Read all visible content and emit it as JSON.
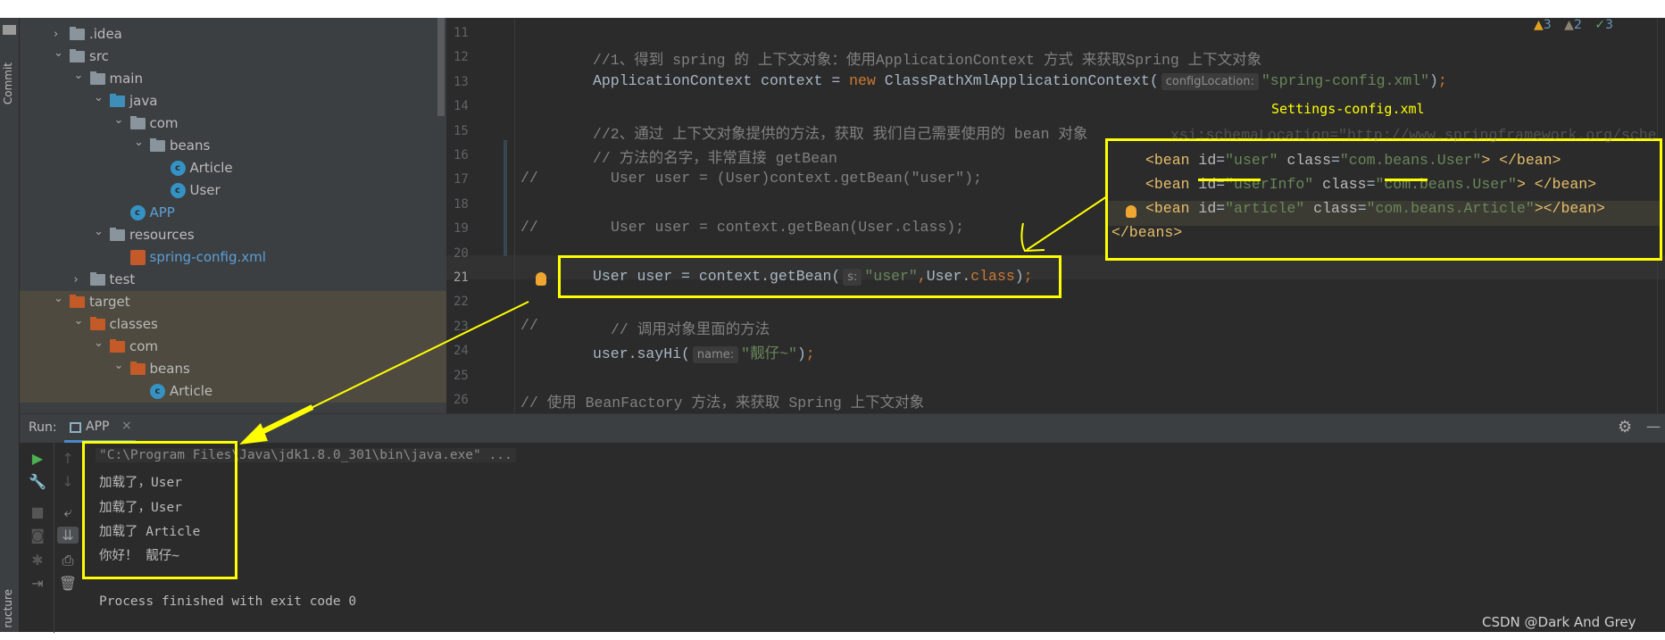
{
  "sidebar_left": {
    "commit_label": "Commit",
    "structure_label": "ructure"
  },
  "project_tree": [
    {
      "label": ".idea",
      "depth": 0,
      "chevron": "right",
      "icon": "folder-gray"
    },
    {
      "label": "src",
      "depth": 0,
      "chevron": "down",
      "icon": "folder-gray"
    },
    {
      "label": "main",
      "depth": 1,
      "chevron": "down",
      "icon": "folder-gray"
    },
    {
      "label": "java",
      "depth": 2,
      "chevron": "down",
      "icon": "folder-blue"
    },
    {
      "label": "com",
      "depth": 3,
      "chevron": "down",
      "icon": "package"
    },
    {
      "label": "beans",
      "depth": 4,
      "chevron": "down",
      "icon": "package"
    },
    {
      "label": "Article",
      "depth": 5,
      "icon": "class"
    },
    {
      "label": "User",
      "depth": 5,
      "icon": "class"
    },
    {
      "label": "APP",
      "depth": 3,
      "icon": "class-run",
      "color": "#5c9fd6"
    },
    {
      "label": "resources",
      "depth": 2,
      "chevron": "down",
      "icon": "folder-resources"
    },
    {
      "label": "spring-config.xml",
      "depth": 3,
      "icon": "xml",
      "color": "#5c9fd6"
    },
    {
      "label": "test",
      "depth": 1,
      "chevron": "right",
      "icon": "folder-gray"
    },
    {
      "label": "target",
      "depth": 0,
      "chevron": "down",
      "icon": "folder-orange",
      "excluded": true
    },
    {
      "label": "classes",
      "depth": 1,
      "chevron": "down",
      "icon": "folder-orange",
      "excluded": true
    },
    {
      "label": "com",
      "depth": 2,
      "chevron": "down",
      "icon": "folder-orange",
      "excluded": true
    },
    {
      "label": "beans",
      "depth": 3,
      "chevron": "down",
      "icon": "folder-orange",
      "excluded": true
    },
    {
      "label": "Article",
      "depth": 4,
      "icon": "class-locked",
      "excluded": true
    }
  ],
  "editor": {
    "inspections": {
      "warnings": "3",
      "weak_warnings": "2",
      "typos": "3"
    },
    "current_line": 21,
    "lines": [
      {
        "n": 11,
        "segs": []
      },
      {
        "n": 12,
        "segs": [
          [
            "c",
            "//1、得到 spring 的 上下文对象：使用ApplicationContext 方式 来获取Spring 上下文对象"
          ]
        ]
      },
      {
        "n": 13,
        "segs": [
          [
            "t",
            "ApplicationContext context = "
          ],
          [
            "k",
            "new "
          ],
          [
            "t",
            "ClassPathXmlApplicationContext("
          ],
          [
            "h",
            "configLocation:"
          ],
          [
            "s",
            "\"spring-config.xml\""
          ],
          [
            "t",
            ")"
          ],
          [
            "k",
            ";"
          ]
        ]
      },
      {
        "n": 14,
        "segs": []
      },
      {
        "n": 15,
        "segs": [
          [
            "c",
            "//2、通过 上下文对象提供的方法，获取 我们自己需要使用的 bean 对象"
          ]
        ]
      },
      {
        "n": 16,
        "segs": [
          [
            "c",
            "// 方法的名字，非常直接 getBean"
          ]
        ]
      },
      {
        "n": 17,
        "gutter": "//",
        "indent": true,
        "segs": [
          [
            "c",
            "User user = (User)context.getBean(\"user\");"
          ]
        ]
      },
      {
        "n": 18,
        "segs": []
      },
      {
        "n": 19,
        "gutter": "//",
        "indent": true,
        "segs": [
          [
            "c",
            "User user = context.getBean(User.class);"
          ]
        ]
      },
      {
        "n": 20,
        "segs": []
      },
      {
        "n": 21,
        "bulb": true,
        "segs": [
          [
            "t",
            "User user = context.getBean("
          ],
          [
            "h",
            "s:"
          ],
          [
            "s",
            "\"user\""
          ],
          [
            "k",
            ","
          ],
          [
            "t",
            "User."
          ],
          [
            "k",
            "class"
          ],
          [
            "t",
            ")"
          ],
          [
            "k",
            ";"
          ]
        ]
      },
      {
        "n": 22,
        "segs": []
      },
      {
        "n": 23,
        "gutter": "//",
        "indent": true,
        "segs": [
          [
            "c",
            "// 调用对象里面的方法"
          ]
        ]
      },
      {
        "n": 24,
        "segs": [
          [
            "t",
            "user.sayHi("
          ],
          [
            "h",
            "name:"
          ],
          [
            "s",
            "\"靓仔~\""
          ],
          [
            "t",
            ")"
          ],
          [
            "k",
            ";"
          ]
        ]
      },
      {
        "n": 25,
        "segs": []
      },
      {
        "n": 26,
        "from_gutter": true,
        "segs": [
          [
            "c",
            "// 使用 BeanFactory 方法，来获取 Spring 上下文对象"
          ]
        ]
      }
    ]
  },
  "annotation": {
    "label": "Settings-config.xml",
    "color": "#ffff00"
  },
  "xml_popup": {
    "cut_line": "xsi:schemaLocation=\"http://www.springframework.org/sche",
    "lines": [
      [
        [
          "tag",
          "<bean "
        ],
        [
          "attr",
          "id"
        ],
        [
          "t",
          "="
        ],
        [
          "s",
          "\"user\""
        ],
        [
          "attr",
          " class"
        ],
        [
          "t",
          "="
        ],
        [
          "s",
          "\"com.beans.User\""
        ],
        [
          "tag",
          "> </bean>"
        ]
      ],
      [
        [
          "tag",
          "<bean "
        ],
        [
          "attr",
          "id"
        ],
        [
          "t",
          "="
        ],
        [
          "s",
          "\"userInfo\""
        ],
        [
          "attr",
          " class"
        ],
        [
          "t",
          "="
        ],
        [
          "s",
          "\"com.beans.User\""
        ],
        [
          "tag",
          "> </bean>"
        ]
      ],
      [
        [
          "tag",
          "<bean "
        ],
        [
          "attr",
          "id"
        ],
        [
          "t",
          "="
        ],
        [
          "s",
          "\"article\""
        ],
        [
          "attr",
          " class"
        ],
        [
          "t",
          "="
        ],
        [
          "s",
          "\"com.beans.Article\""
        ],
        [
          "tag",
          "></bean>"
        ]
      ],
      [
        [
          "tag",
          "</beans>"
        ]
      ]
    ]
  },
  "run": {
    "label": "Run:",
    "tab": "APP",
    "console": [
      "\"C:\\Program Files\\Java\\jdk1.8.0_301\\bin\\java.exe\" ...",
      "加载了，User",
      "加载了，User",
      "加载了 Article",
      "你好！ 靓仔~",
      "",
      "Process finished with exit code 0"
    ]
  },
  "watermark": "CSDN @Dark And Grey"
}
